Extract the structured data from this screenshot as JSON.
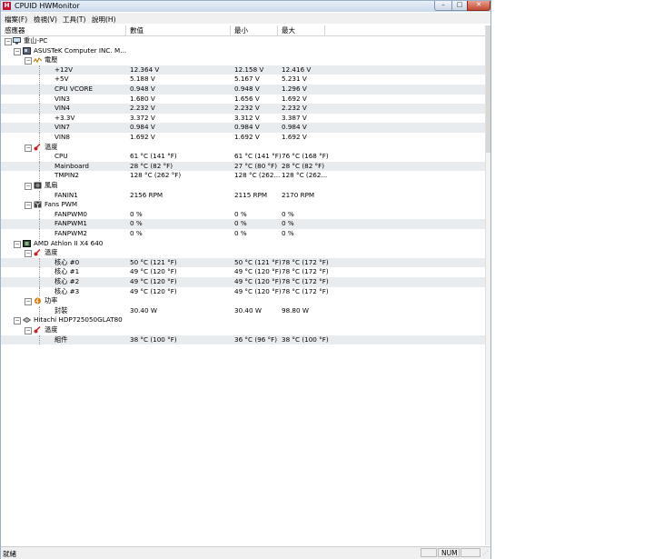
{
  "window": {
    "title": "CPUID HWMonitor",
    "app_icon_letter": "H"
  },
  "title_buttons": {
    "minimize": "–",
    "maximize": "□",
    "close": "✕"
  },
  "menu": [
    "檔案(F)",
    "檢視(V)",
    "工具(T)",
    "說明(H)"
  ],
  "columns": [
    "感應器",
    "數值",
    "最小",
    "最大"
  ],
  "rows": [
    {
      "id": "pc",
      "label": "重山-PC",
      "level": 0,
      "icon": "computer-icon",
      "expander": "−"
    },
    {
      "id": "mb",
      "label": "ASUSTeK Computer INC. M...",
      "level": 1,
      "icon": "motherboard-icon",
      "expander": "−"
    },
    {
      "id": "volt",
      "label": "電壓",
      "level": 2,
      "icon": "voltage-icon",
      "expander": "−"
    },
    {
      "label": "+12V",
      "level": 3,
      "value": "12.364 V",
      "min": "12.158 V",
      "max": "12.416 V"
    },
    {
      "label": "+5V",
      "level": 3,
      "value": "5.188 V",
      "min": "5.167 V",
      "max": "5.231 V"
    },
    {
      "label": "CPU VCORE",
      "level": 3,
      "value": "0.948 V",
      "min": "0.948 V",
      "max": "1.296 V"
    },
    {
      "label": "VIN3",
      "level": 3,
      "value": "1.680 V",
      "min": "1.656 V",
      "max": "1.692 V"
    },
    {
      "label": "VIN4",
      "level": 3,
      "value": "2.232 V",
      "min": "2.232 V",
      "max": "2.232 V"
    },
    {
      "label": "+3.3V",
      "level": 3,
      "value": "3.372 V",
      "min": "3.312 V",
      "max": "3.387 V"
    },
    {
      "label": "VIN7",
      "level": 3,
      "value": "0.984 V",
      "min": "0.984 V",
      "max": "0.984 V"
    },
    {
      "label": "VIN8",
      "level": 3,
      "value": "1.692 V",
      "min": "1.692 V",
      "max": "1.692 V"
    },
    {
      "id": "temp",
      "label": "溫度",
      "level": 2,
      "icon": "thermometer-icon",
      "expander": "−"
    },
    {
      "label": "CPU",
      "level": 3,
      "value": "61 °C  (141 °F)",
      "min": "61 °C  (141 °F)",
      "max": "76 °C  (168 °F)"
    },
    {
      "label": "Mainboard",
      "level": 3,
      "value": "28 °C  (82 °F)",
      "min": "27 °C  (80 °F)",
      "max": "28 °C  (82 °F)"
    },
    {
      "label": "TMPIN2",
      "level": 3,
      "value": "128 °C  (262 °F)",
      "min": "128 °C  (262...",
      "max": "128 °C  (262..."
    },
    {
      "id": "fans",
      "label": "風扇",
      "level": 2,
      "icon": "fan-icon",
      "expander": "−"
    },
    {
      "label": "FANIN1",
      "level": 3,
      "value": "2156 RPM",
      "min": "2115 RPM",
      "max": "2170 RPM"
    },
    {
      "id": "fanspwm",
      "label": "Fans PWM",
      "level": 2,
      "icon": "fan-pwm-icon",
      "expander": "−"
    },
    {
      "label": "FANPWM0",
      "level": 3,
      "value": "0 %",
      "min": "0 %",
      "max": "0 %"
    },
    {
      "label": "FANPWM1",
      "level": 3,
      "value": "0 %",
      "min": "0 %",
      "max": "0 %"
    },
    {
      "label": "FANPWM2",
      "level": 3,
      "value": "0 %",
      "min": "0 %",
      "max": "0 %"
    },
    {
      "id": "cpu",
      "label": "AMD Athlon II X4 640",
      "level": 1,
      "icon": "cpu-icon",
      "expander": "−"
    },
    {
      "id": "cputemp",
      "label": "溫度",
      "level": 2,
      "icon": "thermometer-icon",
      "expander": "−"
    },
    {
      "label": "核心 #0",
      "level": 3,
      "value": "50 °C  (121 °F)",
      "min": "50 °C  (121 °F)",
      "max": "78 °C  (172 °F)"
    },
    {
      "label": "核心 #1",
      "level": 3,
      "value": "49 °C  (120 °F)",
      "min": "49 °C  (120 °F)",
      "max": "78 °C  (172 °F)"
    },
    {
      "label": "核心 #2",
      "level": 3,
      "value": "49 °C  (120 °F)",
      "min": "49 °C  (120 °F)",
      "max": "78 °C  (172 °F)"
    },
    {
      "label": "核心 #3",
      "level": 3,
      "value": "49 °C  (120 °F)",
      "min": "49 °C  (120 °F)",
      "max": "78 °C  (172 °F)"
    },
    {
      "id": "power",
      "label": "功率",
      "level": 2,
      "icon": "power-icon",
      "expander": "−"
    },
    {
      "label": "封裝",
      "level": 3,
      "value": "30.40 W",
      "min": "30.40 W",
      "max": "98.80 W"
    },
    {
      "id": "hdd",
      "label": "Hitachi HDP725050GLAT80",
      "level": 1,
      "icon": "hdd-icon",
      "expander": "−"
    },
    {
      "id": "hddtemp",
      "label": "溫度",
      "level": 2,
      "icon": "thermometer-icon",
      "expander": "−"
    },
    {
      "label": "組件",
      "level": 3,
      "value": "38 °C  (100 °F)",
      "min": "36 °C  (96 °F)",
      "max": "38 °C  (100 °F)"
    }
  ],
  "status": {
    "text": "就緒",
    "num": "NUM"
  }
}
